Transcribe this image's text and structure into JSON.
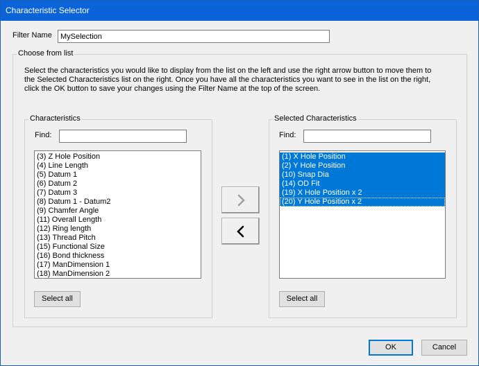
{
  "window": {
    "title": "Characteristic Selector"
  },
  "filter": {
    "label": "Filter Name",
    "value": "MySelection"
  },
  "choose_group": {
    "label": "Choose from list",
    "description": "Select the characteristics you would like to display from the list on the left and use the right arrow button to move them to the Selected Characteristics list on the right. Once you have all the characteristics you want to see in the list on the right, click the OK button to save your changes using the Filter Name at the top of the screen."
  },
  "characteristics": {
    "label": "Characteristics",
    "find_label": "Find:",
    "find_value": "",
    "items": [
      "(3) Z Hole Position",
      "(4) Line Length",
      "(5) Datum 1",
      "(6) Datum 2",
      "(7) Datum 3",
      "(8) Datum 1 - Datum2",
      "(9) Chamfer Angle",
      "(11) Overall Length",
      "(12) Ring length",
      "(13) Thread Pitch",
      "(15) Functional Size",
      "(16) Bond thickness",
      "(17) ManDimension 1",
      "(18) ManDimension 2"
    ],
    "select_all": "Select all"
  },
  "selected": {
    "label": "Selected Characteristics",
    "find_label": "Find:",
    "find_value": "",
    "items": [
      "(1) X Hole Position",
      "(2) Y Hole Position",
      "(10) Snap Dia",
      "(14) OD Fit",
      "(19) X Hole Position x 2",
      "(20) Y Hole Position x 2"
    ],
    "select_all": "Select all"
  },
  "icons": {
    "add": "chevron-right-icon",
    "remove": "chevron-left-icon"
  },
  "footer": {
    "ok": "OK",
    "cancel": "Cancel"
  }
}
